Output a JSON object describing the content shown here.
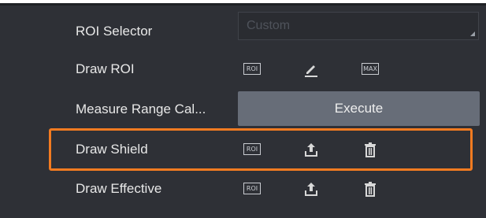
{
  "rows": {
    "roi_selector": {
      "label": "ROI Selector",
      "select_value": "Custom"
    },
    "draw_roi": {
      "label": "Draw ROI",
      "roi_icon_text": "ROI",
      "max_icon_text": "MAX"
    },
    "measure_range": {
      "label": "Measure Range Cal...",
      "button_label": "Execute"
    },
    "draw_shield": {
      "label": "Draw Shield",
      "roi_icon_text": "ROI"
    },
    "draw_effective": {
      "label": "Draw Effective",
      "roi_icon_text": "ROI"
    }
  },
  "highlight_color": "#f37b21",
  "icons": [
    "roi-icon",
    "pencil-icon",
    "max-icon",
    "upload-icon",
    "trash-icon"
  ]
}
